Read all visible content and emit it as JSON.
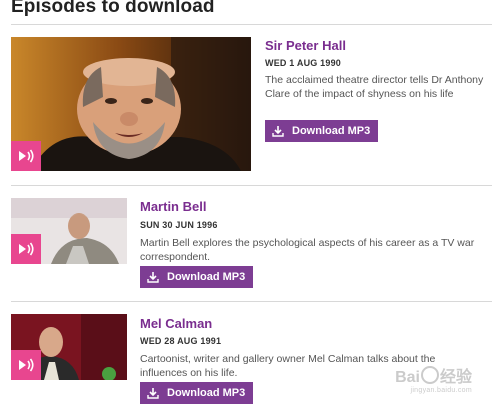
{
  "heading": "Episodes to download",
  "episodes": [
    {
      "title": "Sir Peter Hall",
      "date": "WED 1 AUG 1990",
      "description": "The acclaimed theatre director tells Dr Anthony Clare of the impact of shyness on his life",
      "button": "Download MP3"
    },
    {
      "title": "Martin Bell",
      "date": "SUN 30 JUN 1996",
      "description": "Martin Bell explores the psychological aspects of his career as a TV war correspondent.",
      "button": "Download MP3"
    },
    {
      "title": "Mel Calman",
      "date": "WED 28 AUG 1991",
      "description": "Cartoonist, writer and gallery owner Mel Calman talks about the influences on his life.",
      "button": "Download MP3"
    }
  ],
  "watermark": {
    "text_left": "Bai",
    "text_right": "经验",
    "sub": "jingyan.baidu.com"
  },
  "colors": {
    "title": "#7a2d8f",
    "button": "#7d3d93",
    "play_badge": "#e8468f"
  },
  "icons": {
    "play_badge": "audio-play-icon",
    "download": "download-arrow-icon"
  }
}
